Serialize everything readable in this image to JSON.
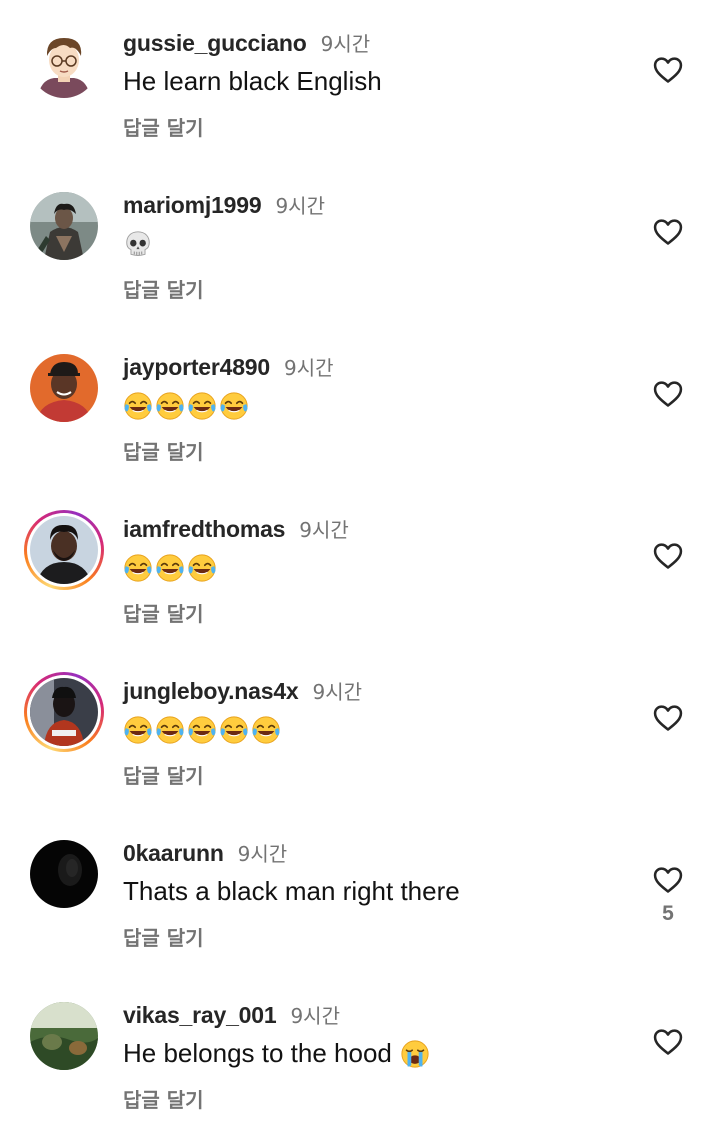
{
  "colors": {
    "username": "#262626",
    "meta_gray": "#737373",
    "text": "#121212",
    "background": "#ffffff"
  },
  "icons": {
    "like": "heart-outline-icon",
    "laugh": "face-with-tears-of-joy-emoji",
    "skull": "skull-emoji",
    "cry": "loudly-crying-face-emoji"
  },
  "comments": [
    {
      "username": "gussie_gucciano",
      "time": "9시간",
      "text": "He learn black English",
      "reply": "답글 달기"
    },
    {
      "username": "mariomj1999",
      "time": "9시간",
      "emoji": "skull",
      "reply": "답글 달기"
    },
    {
      "username": "jayporter4890",
      "time": "9시간",
      "emoji": "laugh x4",
      "reply": "답글 달기"
    },
    {
      "username": "iamfredthomas",
      "time": "9시간",
      "emoji": "laugh x3",
      "reply": "답글 달기",
      "story_ring": true
    },
    {
      "username": "jungleboy.nas4x",
      "time": "9시간",
      "emoji": "laugh x5",
      "reply": "답글 달기",
      "story_ring": true
    },
    {
      "username": "0kaarunn",
      "time": "9시간",
      "text": "Thats a black man right there",
      "reply": "답글 달기",
      "likes": "5"
    },
    {
      "username": "vikas_ray_001",
      "time": "9시간",
      "text": "He belongs to the hood",
      "emoji_after": "cry",
      "reply": "답글 달기"
    }
  ]
}
